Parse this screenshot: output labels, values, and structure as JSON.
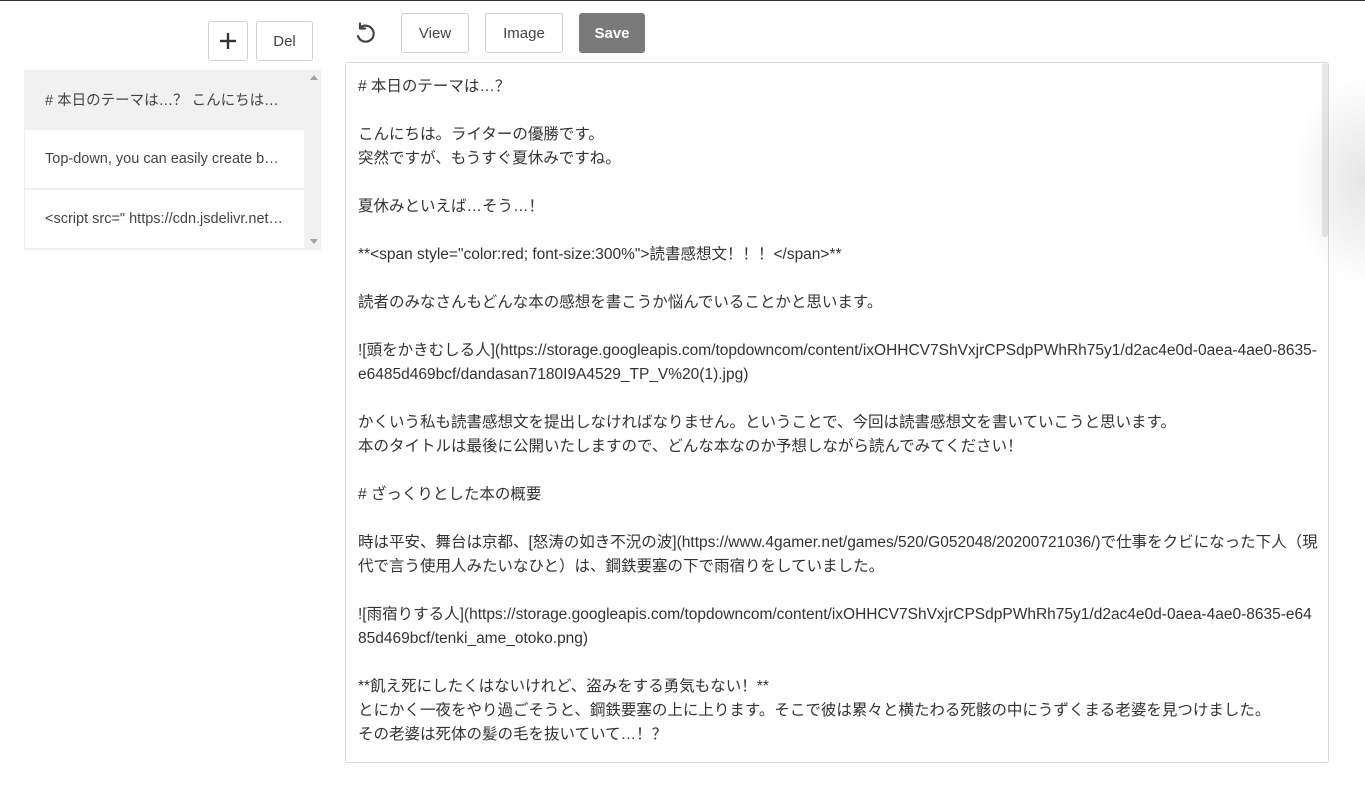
{
  "toolbar": {
    "add_icon": "plus-icon",
    "delete_label": "Del",
    "undo_icon": "undo-icon",
    "view_label": "View",
    "image_label": "Image",
    "save_label": "Save"
  },
  "notes": [
    {
      "preview": "# 本日のテーマは…？ こんにちは。ライターの優勝です。"
    },
    {
      "preview": "Top-down, you can easily create beautiful articles"
    },
    {
      "preview": "<script src=\" https://cdn.jsdelivr.net/npm/mermaid/dist/mermaid.min.js\">"
    }
  ],
  "editor": {
    "content": "# 本日のテーマは…？\n\nこんにちは。ライターの優勝です。\n突然ですが、もうすぐ夏休みですね。\n\n夏休みといえば…そう…！\n\n**<span style=\"color:red; font-size:300%\">読書感想文！！！</span>**\n\n読者のみなさんもどんな本の感想を書こうか悩んでいることかと思います。\n\n![頭をかきむしる人](https://storage.googleapis.com/topdowncom/content/ixOHHCV7ShVxjrCPSdpPWhRh75y1/d2ac4e0d-0aea-4ae0-8635-e6485d469bcf/dandasan7180I9A4529_TP_V%20(1).jpg)\n\nかくいう私も読書感想文を提出しなければなりません。ということで、今回は読書感想文を書いていこうと思います。\n本のタイトルは最後に公開いたしますので、どんな本なのか予想しながら読んでみてください！\n\n# ざっくりとした本の概要\n\n時は平安、舞台は京都、[怒涛の如き不況の波](https://www.4gamer.net/games/520/G052048/20200721036/)で仕事をクビになった下人（現代で言う使用人みたいなひと）は、鋼鉄要塞の下で雨宿りをしていました。\n\n![雨宿りする人](https://storage.googleapis.com/topdowncom/content/ixOHHCV7ShVxjrCPSdpPWhRh75y1/d2ac4e0d-0aea-4ae0-8635-e6485d469bcf/tenki_ame_otoko.png)\n\n**飢え死にしたくはないけれど、盗みをする勇気もない！**\nとにかく一夜をやり過ごそうと、鋼鉄要塞の上に上ります。そこで彼は累々と横たわる死骸の中にうずくまる老婆を見つけました。\nその老婆は死体の髪の毛を抜いていて…！？"
  }
}
